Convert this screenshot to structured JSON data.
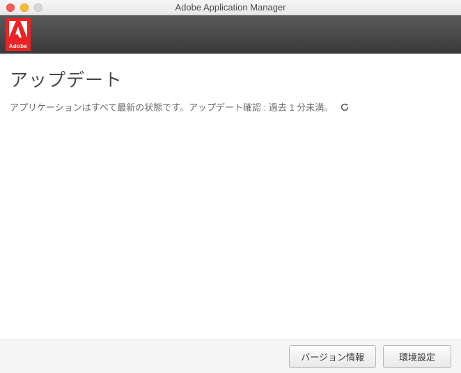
{
  "window": {
    "title": "Adobe Application Manager"
  },
  "header": {
    "logo_text": "Adobe"
  },
  "main": {
    "title": "アップデート",
    "status_text": "アプリケーションはすべて最新の状態です。アップデート確認 : 過去 1 分未満。"
  },
  "footer": {
    "version_button": "バージョン情報",
    "settings_button": "環境設定"
  }
}
